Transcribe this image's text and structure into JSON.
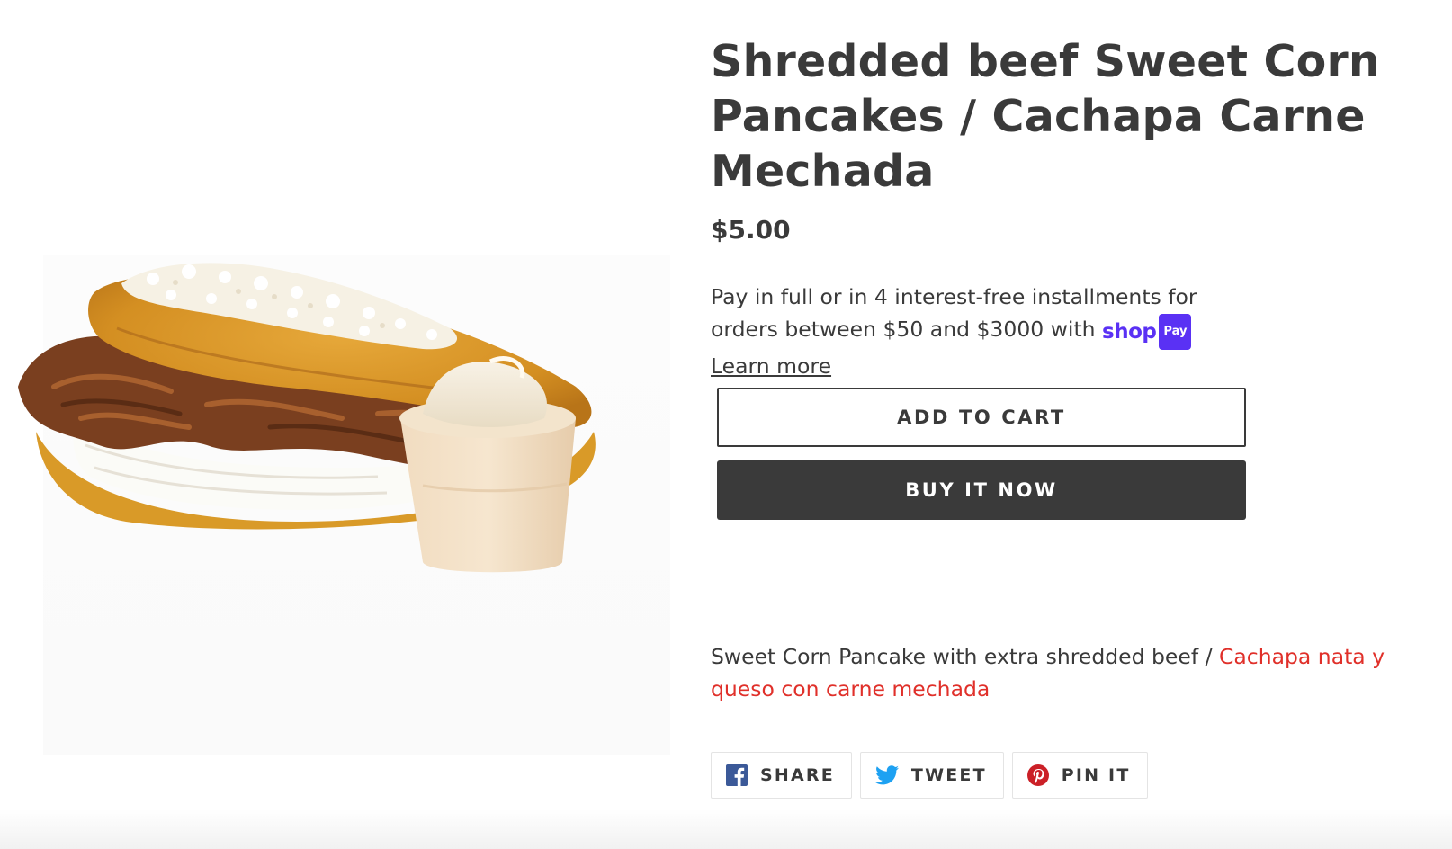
{
  "product": {
    "title": "Shredded beef Sweet Corn Pancakes / Cachapa Carne Mechada",
    "price": "$5.00",
    "image_alt": "Cachapa with shredded beef, queso and cream cup"
  },
  "installments": {
    "text": "Pay in full or in 4 interest-free installments for orders between $50 and $3000 with",
    "logo_shop": "shop",
    "logo_pay": "Pay",
    "learn_more": "Learn more"
  },
  "buttons": {
    "add_to_cart": "ADD TO CART",
    "buy_it_now": "BUY IT NOW"
  },
  "description": {
    "plain": "Sweet Corn Pancake with extra shredded beef / ",
    "accent": "Cachapa nata y queso con carne mechada"
  },
  "share": [
    {
      "label": "SHARE",
      "icon": "facebook-icon",
      "color": "#3b5998"
    },
    {
      "label": "TWEET",
      "icon": "twitter-icon",
      "color": "#1da1f2"
    },
    {
      "label": "PIN IT",
      "icon": "pinterest-icon",
      "color": "#cb2027"
    }
  ],
  "colors": {
    "text": "#3a3a3a",
    "accent": "#e0302a",
    "shop_pay": "#5a31f4",
    "button_dark": "#3a3a3a"
  }
}
